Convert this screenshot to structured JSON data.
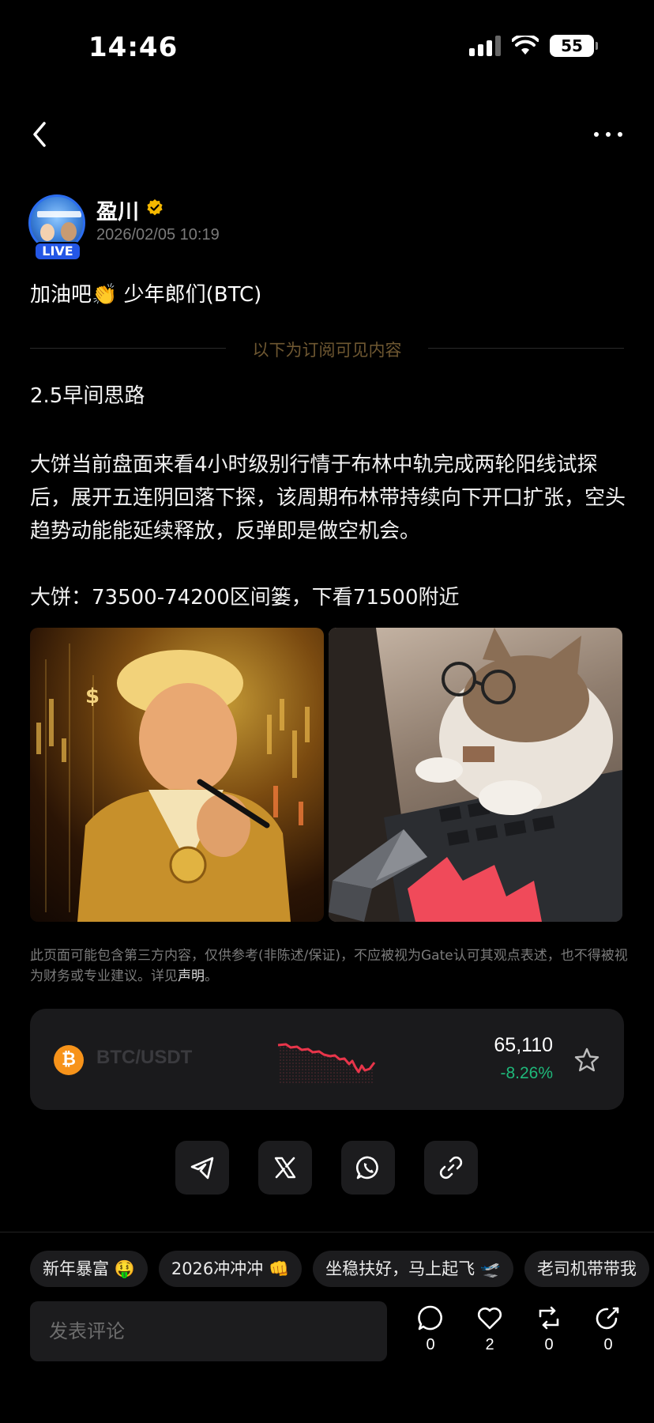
{
  "status_bar": {
    "time": "14:46",
    "battery": "55"
  },
  "author": {
    "name": "盈川",
    "date": "2026/02/05 10:19",
    "live_label": "LIVE"
  },
  "post": {
    "title": "加油吧👏 少年郎们(BTC)",
    "subscriber_divider": "以下为订阅可见内容",
    "heading": "2.5早间思路",
    "paragraph": "大饼当前盘面来看4小时级别行情于布林中轨完成两轮阳线试探后，展开五连阴回落下探，该周期布林带持续向下开口扩张，空头趋势动能能延续释放，反弹即是做空机会。",
    "strategy": "大饼：73500-74200区间篓，下看71500附近"
  },
  "disclaimer": {
    "text": "此页面可能包含第三方内容，仅供参考(非陈述/保证)，不应被视为Gate认可其观点表述，也不得被视为财务或专业建议。详见",
    "link": "声明",
    "end": "。"
  },
  "ticker": {
    "coin_symbol": "₿",
    "pair": "BTC/USDT",
    "price": "65,110",
    "change": "-8.26%",
    "change_color": "#1fb87a",
    "spark_color": "#e8354a"
  },
  "chips": [
    "新年暴富 🤑",
    "2026冲冲冲 👊",
    "坐稳扶好，马上起飞 🛫",
    "老司机带带我"
  ],
  "bottom_bar": {
    "comment_placeholder": "发表评论",
    "comment_count": "0",
    "like_count": "2",
    "repost_count": "0",
    "share_count": "0"
  }
}
